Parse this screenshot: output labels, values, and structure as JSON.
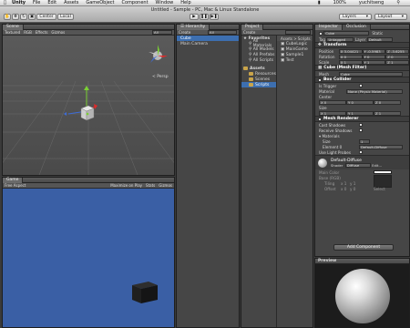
{
  "menubar": {
    "apple": "",
    "items": [
      "Unity",
      "File",
      "Edit",
      "Assets",
      "GameObject",
      "Component",
      "Window",
      "Help"
    ],
    "user": "yuchitseng",
    "zoom": "100%"
  },
  "toolbar": {
    "title": "Untitled - Sample - PC, Mac & Linux Standalone",
    "pivot": "Center",
    "space": "Local",
    "layers": "Layers",
    "layout": "Layout"
  },
  "scene": {
    "tab": "Scene",
    "shading": "Textured",
    "mode": "RGB",
    "effects": "Effects",
    "gizmos": "Gizmos",
    "search": "All",
    "persp": "< Persp"
  },
  "game": {
    "tab": "Game",
    "aspect": "Free Aspect",
    "maximize": "Maximize on Play",
    "stats": "Stats",
    "gizmos": "Gizmos"
  },
  "hierarchy": {
    "tab": "Hierarchy",
    "create": "Create",
    "search": "All",
    "items": [
      "Cube",
      "Main Camera"
    ]
  },
  "project": {
    "tab": "Project",
    "create": "Create",
    "favorites_label": "Favorites",
    "favorites": [
      "All Materials",
      "All Models",
      "All Prefabs",
      "All Scripts"
    ],
    "assets_label": "Assets",
    "asset_folders": [
      "Resources",
      "Scenes",
      "Scripts"
    ],
    "breadcrumb": "Assets > Scripts",
    "files": [
      "CubeLogic",
      "MainGame",
      "Sample1",
      "Test"
    ]
  },
  "inspector": {
    "tab": "Inspector",
    "tab2": "Occlusion",
    "object_name": "Cube",
    "static": "Static",
    "tag_label": "Tag",
    "tag": "Untagged",
    "layer_label": "Layer",
    "layer": "Default",
    "transform": {
      "title": "Transform",
      "position_label": "Position",
      "rotation_label": "Rotation",
      "scale_label": "Scale",
      "position": [
        "X 3.04421",
        "Y -0.5983",
        "Z -3.6255"
      ],
      "rotation": [
        "X 0",
        "Y 0",
        "Z 0"
      ],
      "scale": [
        "X 1",
        "Y 1",
        "Z 1"
      ]
    },
    "mesh_filter": {
      "title": "Cube (Mesh Filter)",
      "mesh_label": "Mesh",
      "mesh": "Cube"
    },
    "box_collider": {
      "title": "Box Collider",
      "trigger": "Is Trigger",
      "material": "Material",
      "material_value": "None (Physic Material)",
      "center": "Center",
      "center_values": [
        "X 0",
        "Y 0",
        "Z 0"
      ],
      "size": "Size",
      "size_values": [
        "X 1",
        "Y 1",
        "Z 1"
      ]
    },
    "mesh_renderer": {
      "title": "Mesh Renderer",
      "cast": "Cast Shadows",
      "receive": "Receive Shadows",
      "materials": "Materials",
      "size_label": "Size",
      "size_value": "1",
      "element_label": "Element 0",
      "element_value": "Default-Diffuse",
      "light_probes": "Use Light Probes"
    },
    "material": {
      "name": "Default-Diffuse",
      "shader_label": "Shader",
      "shader": "Diffuse",
      "edit": "Edit...",
      "main_color": "Main Color",
      "base_label": "Base (RGB)",
      "tiling_label": "Tiling",
      "offset_label": "Offset",
      "tiling": [
        "x 1",
        "y 1"
      ],
      "offset": [
        "x 0",
        "y 0"
      ],
      "select": "Select"
    },
    "add_component": "Add Component"
  },
  "preview": {
    "label": "Preview"
  },
  "colors": {
    "game_bg": "#3a5fa5",
    "selection": "#3d6fb0"
  }
}
